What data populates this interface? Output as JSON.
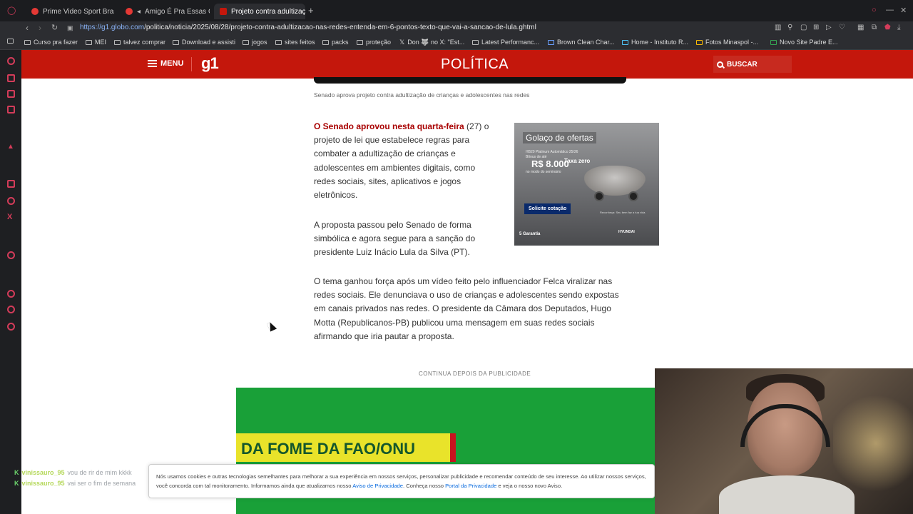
{
  "tabs": [
    {
      "title": "Prime Video Sport Brasil",
      "color": "#e53935"
    },
    {
      "title": "Amigo É Pra Essas Co",
      "color": "#e53935"
    },
    {
      "title": "Projeto contra adultização",
      "color": "#c4170c"
    }
  ],
  "address": {
    "url_host": "https://g1.globo.com",
    "url_path": "/politica/noticia/2025/08/28/projeto-contra-adultizacao-nas-redes-entenda-em-6-pontos-texto-que-vai-a-sancao-de-lula.ghtml"
  },
  "bookmarks": [
    "Curso pra fazer",
    "MEI",
    "talvez comprar",
    "Download e assisti",
    "jogos",
    "sites feitos",
    "packs",
    "proteção",
    "Don 🐺 no X: \"Est...",
    "Latest Performanc...",
    "Brown Clean Char...",
    "Home - Instituto R...",
    "Fotos Minaspol -...",
    "Novo Site Padre E..."
  ],
  "header": {
    "menu_label": "MENU",
    "logo": "g1",
    "section": "POLÍTICA",
    "search_label": "BUSCAR"
  },
  "article": {
    "video_caption": "Senado aprova projeto contra adultização de crianças e adolescentes nas redes",
    "p1_lead": "O Senado aprovou nesta quarta-feira",
    "p1_rest": " (27) o projeto de lei que estabelece regras para combater a adultização de crianças e adolescentes em ambientes digitais, como redes sociais, sites, aplicativos e jogos eletrônicos.",
    "p2": "A proposta passou pelo Senado de forma simbólica e agora segue para a sanção do presidente Luiz Inácio Lula da Silva (PT).",
    "p3": "O tema ganhou força após um vídeo feito pelo influenciador Felca viralizar nas redes sociais. Ele denunciava o uso de crianças e adolescentes sendo expostas em canais privados nas redes. O presidente da Câmara dos Deputados, Hugo Motta (Republicanos-PB) publicou uma mensagem em suas redes sociais afirmando que iria pautar a proposta."
  },
  "ad": {
    "title": "Golaço de ofertas",
    "line1": "HB20 Platinum Automático 25/26",
    "line2": "Bônus de até",
    "price": "R$ 8.000",
    "taxa": "Taxa zero",
    "line3": "no modo do seminário",
    "cta": "Solicite cotação",
    "small": "Reconheça: Seu bem faz a tua vida.",
    "foot": "5 Garantia",
    "brand": "HYUNDAI"
  },
  "continua_label": "CONTINUA DEPOIS DA PUBLICIDADE",
  "banner_text": "DA FOME DA FAO/ONU",
  "cookie": {
    "text1": "Nós usamos cookies e outras tecnologias semelhantes para melhorar a sua experiência em nossos serviços, personalizar publicidade e recomendar conteúdo de seu interesse. Ao utilizar nossos serviços, você concorda com tal monitoramento. Informamos ainda que atualizamos nosso ",
    "link1": "Aviso de Privacidade",
    "text2": ". Conheça nosso ",
    "link2": "Portal da Privacidade",
    "text3": " e veja o nosso novo Aviso."
  },
  "chat": [
    {
      "user": "vinissauro_95",
      "msg": "vou de rir de mim kkkk"
    },
    {
      "user": "vinissauro_95",
      "msg": "vai ser o fim de semana"
    }
  ]
}
